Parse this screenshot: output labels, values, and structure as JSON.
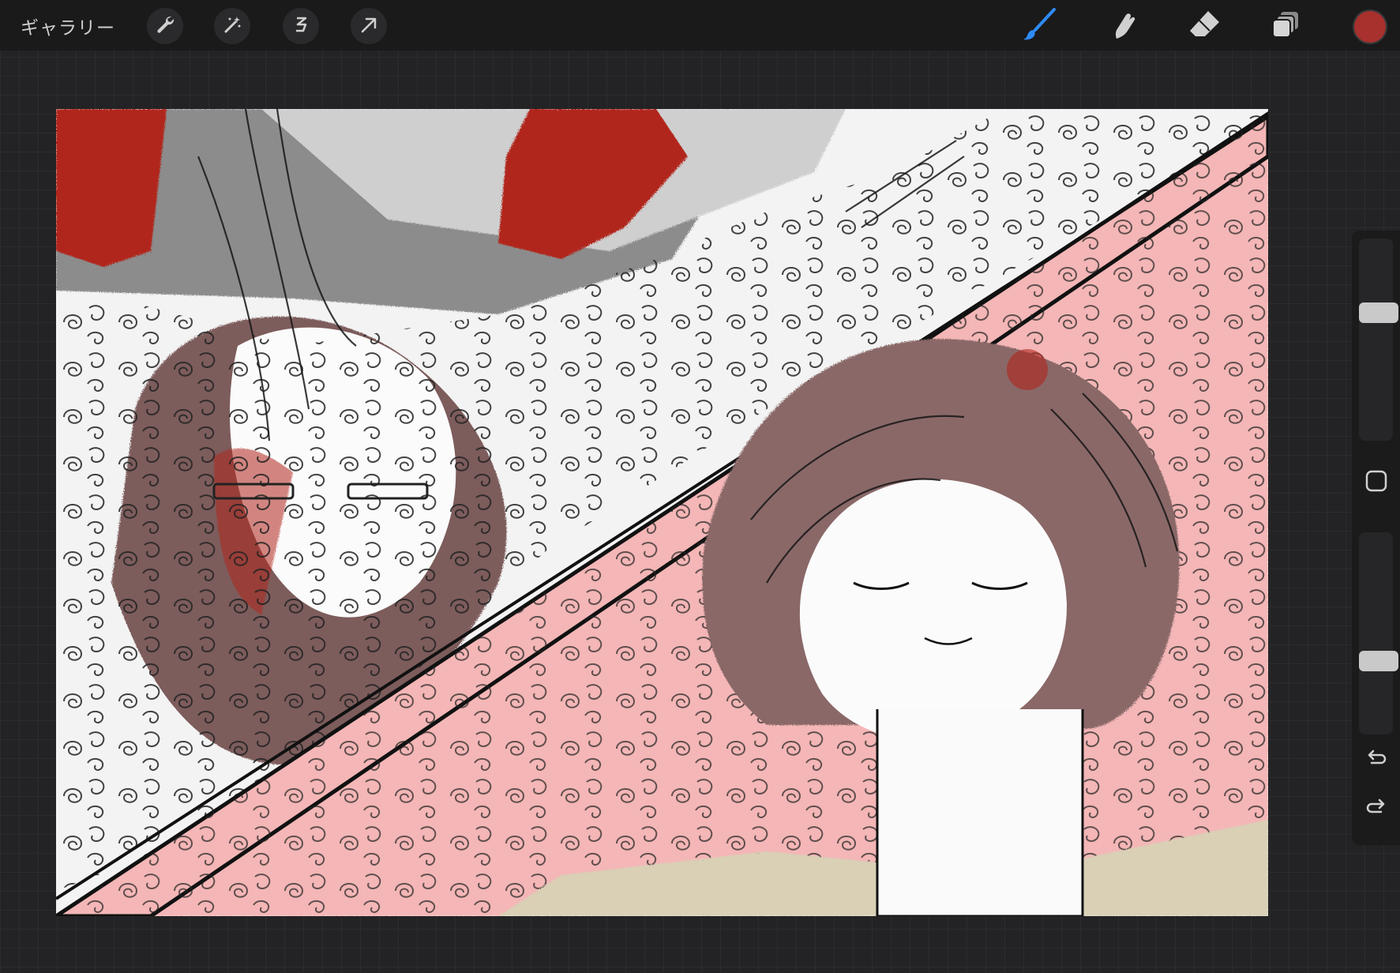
{
  "topbar": {
    "gallery_label": "ギャラリー",
    "tools_left": [
      "wrench-icon",
      "magic-wand-icon",
      "selection-icon",
      "transform-arrow-icon"
    ],
    "tools_right": [
      "brush-icon",
      "smudge-icon",
      "eraser-icon",
      "layers-icon"
    ],
    "active_tool": "brush-icon",
    "active_color": "#a8302d"
  },
  "canvas": {
    "description_colors": {
      "background": "#fafafa",
      "pink": "#f4b6b6",
      "red": "#b1271c",
      "gray": "#8c8c8c",
      "light_gray": "#d0d0d0",
      "brown": "#7d5b5b",
      "beige": "#d9d0b6"
    }
  },
  "sidebar": {
    "brush_size_level": 0.65,
    "opacity_level": 0.35,
    "buttons": [
      "modifier-square-icon",
      "undo-icon",
      "redo-icon"
    ]
  }
}
